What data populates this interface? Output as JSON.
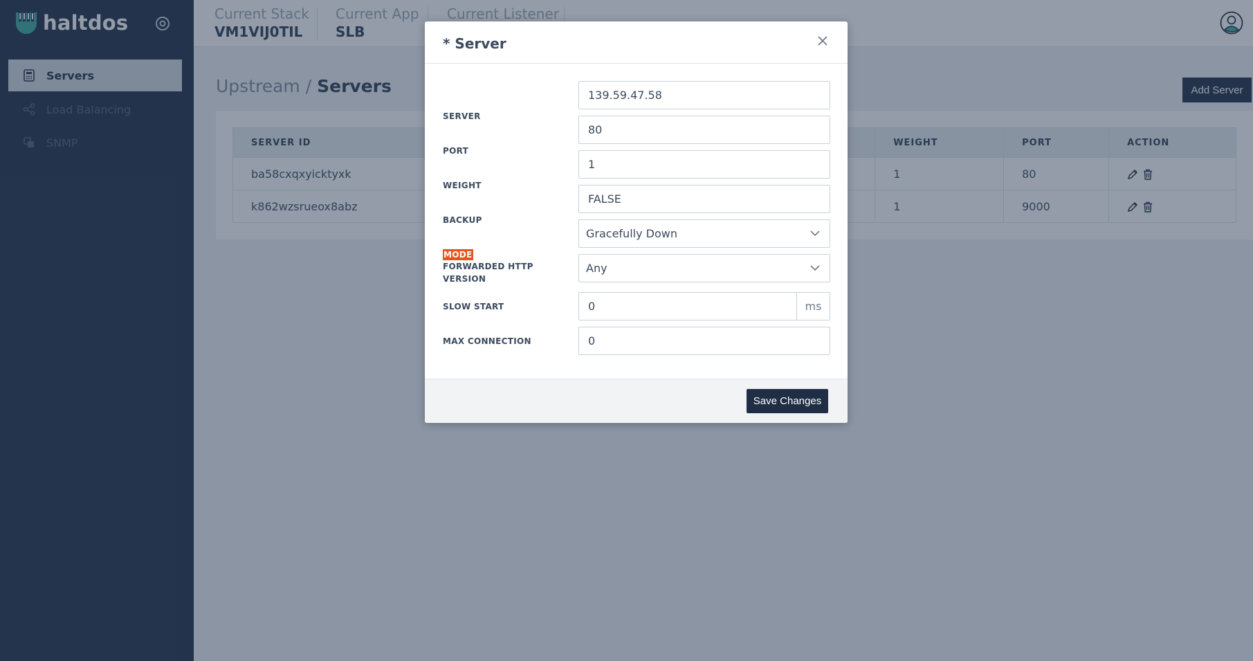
{
  "app": {
    "logo_text": "haltdos"
  },
  "sidebar": {
    "items": [
      {
        "label": "Servers",
        "icon": "calculator-icon",
        "active": true
      },
      {
        "label": "Load Balancing",
        "icon": "share-icon",
        "active": false
      },
      {
        "label": "SNMP",
        "icon": "layers-icon",
        "active": false
      }
    ]
  },
  "header": {
    "context": [
      {
        "label": "Current Stack",
        "value": "VM1VIJ0TIL"
      },
      {
        "label": "Current App",
        "value": "SLB"
      },
      {
        "label": "Current Listener",
        "value": ""
      }
    ]
  },
  "page": {
    "breadcrumb_parent": "Upstream",
    "breadcrumb_sep": " / ",
    "breadcrumb_current": "Servers",
    "add_button": "Add Server"
  },
  "table": {
    "headers": [
      "SERVER ID",
      "WEIGHT",
      "PORT",
      "ACTION"
    ],
    "rows": [
      {
        "id": "ba58cxqxyicktyxk",
        "weight": "1",
        "port": "80"
      },
      {
        "id": "k862wzsrueox8abz",
        "weight": "1",
        "port": "9000"
      }
    ]
  },
  "modal": {
    "title": "* Server",
    "fields": {
      "server": {
        "label": "SERVER",
        "value": "139.59.47.58"
      },
      "port": {
        "label": "PORT",
        "value": "80"
      },
      "weight": {
        "label": "WEIGHT",
        "value": "1"
      },
      "backup": {
        "label": "BACKUP",
        "value": "FALSE"
      },
      "mode": {
        "label": "MODE",
        "value": "Gracefully Down"
      },
      "http_version": {
        "label": "FORWARDED HTTP VERSION",
        "value": "Any"
      },
      "slow_start": {
        "label": "SLOW START",
        "value": "0",
        "unit": "ms"
      },
      "max_connection": {
        "label": "MAX CONNECTION",
        "value": "0"
      }
    },
    "save_button": "Save Changes"
  },
  "colors": {
    "sidebar_bg": "#1f2d45",
    "accent_teal": "#3aa99f",
    "highlight": "#e8541e"
  }
}
